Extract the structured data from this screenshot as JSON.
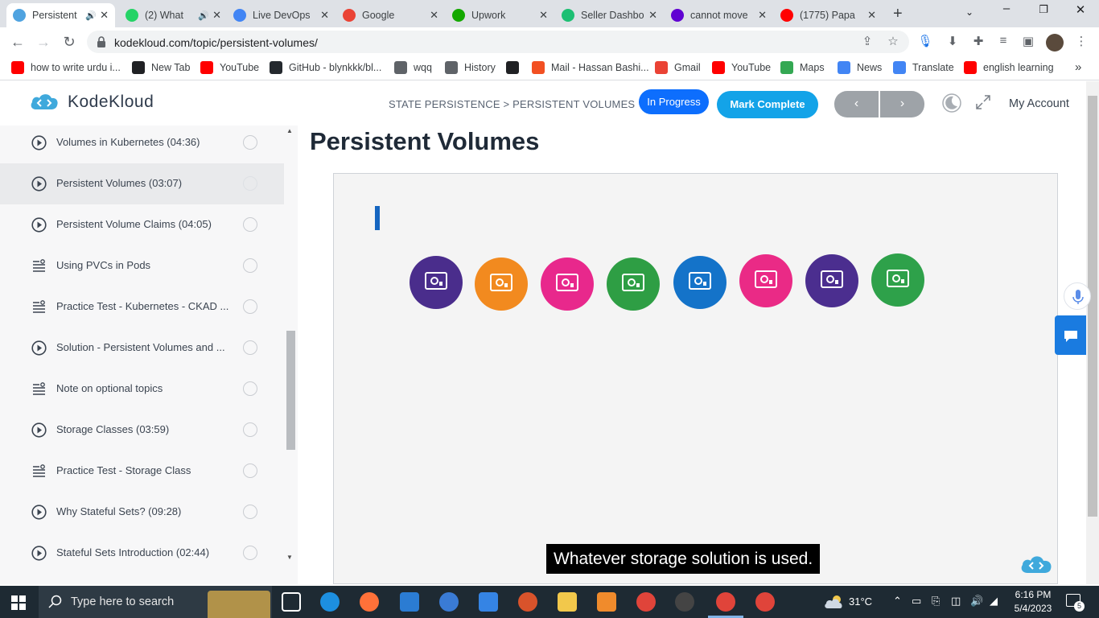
{
  "browser": {
    "tabs": [
      {
        "label": "Persistent",
        "color": "#4fa3e0",
        "active": true,
        "audio": true
      },
      {
        "label": "(2) What",
        "color": "#25d366",
        "active": false,
        "audio": true
      },
      {
        "label": "Live DevOps",
        "color": "#4285f4",
        "active": false,
        "audio": false
      },
      {
        "label": "Google",
        "color": "#ea4335",
        "active": false,
        "audio": false
      },
      {
        "label": "Upwork",
        "color": "#14a800",
        "active": false,
        "audio": false
      },
      {
        "label": "Seller Dashbo",
        "color": "#1dbf73",
        "active": false,
        "audio": false
      },
      {
        "label": "cannot move",
        "color": "#6001d2",
        "active": false,
        "audio": false
      },
      {
        "label": "(1775) Papa",
        "color": "#ff0000",
        "active": false,
        "audio": false
      }
    ],
    "new_tab": "+",
    "url": "kodekloud.com/topic/persistent-volumes/",
    "bookmarks": [
      {
        "label": "how to write urdu i...",
        "color": "#ff0000"
      },
      {
        "label": "New Tab",
        "color": "#202124"
      },
      {
        "label": "YouTube",
        "color": "#ff0000"
      },
      {
        "label": "GitHub - blynkkk/bl...",
        "color": "#24292e"
      },
      {
        "label": "wqq",
        "color": "#5f6368"
      },
      {
        "label": "History",
        "color": "#5f6368"
      },
      {
        "label": "",
        "color": "#202124"
      },
      {
        "label": "Mail - Hassan Bashi...",
        "color": "#f25022"
      },
      {
        "label": "Gmail",
        "color": "#ea4335"
      },
      {
        "label": "YouTube",
        "color": "#ff0000"
      },
      {
        "label": "Maps",
        "color": "#34a853"
      },
      {
        "label": "News",
        "color": "#4285f4"
      },
      {
        "label": "Translate",
        "color": "#4285f4"
      },
      {
        "label": "english learning",
        "color": "#ff0000"
      }
    ],
    "more": "»"
  },
  "header": {
    "logo_text": "KodeKloud",
    "breadcrumb": "STATE PERSISTENCE > PERSISTENT VOLUMES",
    "in_progress": "In Progress",
    "mark_complete": "Mark Complete",
    "prev": "‹",
    "next": "›",
    "account": "My Account"
  },
  "sidebar": {
    "lessons": [
      {
        "label": "Volumes in Kubernetes (04:36)",
        "type": "video",
        "selected": false
      },
      {
        "label": "Persistent Volumes (03:07)",
        "type": "video",
        "selected": true
      },
      {
        "label": "Persistent Volume Claims (04:05)",
        "type": "video",
        "selected": false
      },
      {
        "label": "Using PVCs in Pods",
        "type": "text",
        "selected": false
      },
      {
        "label": "Practice Test - Kubernetes - CKAD ...",
        "type": "text",
        "selected": false
      },
      {
        "label": "Solution - Persistent Volumes and ...",
        "type": "video",
        "selected": false
      },
      {
        "label": "Note on optional topics",
        "type": "text",
        "selected": false
      },
      {
        "label": "Storage Classes (03:59)",
        "type": "video",
        "selected": false
      },
      {
        "label": "Practice Test - Storage Class",
        "type": "text",
        "selected": false
      },
      {
        "label": "Why Stateful Sets? (09:28)",
        "type": "video",
        "selected": false
      },
      {
        "label": "Stateful Sets Introduction (02:44)",
        "type": "video",
        "selected": false
      }
    ]
  },
  "main": {
    "title": "Persistent Volumes",
    "video": {
      "volumes": [
        "#4a2d8c",
        "#f28a1f",
        "#e8288c",
        "#2e9e44",
        "#1473c9",
        "#ea2a86",
        "#4b2e8f",
        "#2ea14a"
      ],
      "caption": "Whatever storage solution is used."
    }
  },
  "taskbar": {
    "search_placeholder": "Type here to search",
    "weather": "31°C",
    "time": "6:16 PM",
    "date": "5/4/2023",
    "notifications": "5"
  }
}
